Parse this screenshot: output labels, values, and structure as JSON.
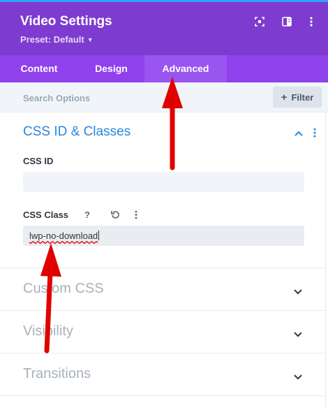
{
  "header": {
    "title": "Video Settings",
    "preset_label": "Preset: Default",
    "icons": [
      "focus-icon",
      "split-view-icon",
      "more-vertical-icon"
    ]
  },
  "tabs": [
    {
      "label": "Content",
      "active": false
    },
    {
      "label": "Design",
      "active": false
    },
    {
      "label": "Advanced",
      "active": true
    }
  ],
  "search": {
    "placeholder": "Search Options",
    "value": "",
    "filter_label": "Filter"
  },
  "sections": {
    "css": {
      "title": "CSS ID & Classes",
      "expanded": true,
      "css_id": {
        "label": "CSS ID",
        "value": ""
      },
      "css_class": {
        "label": "CSS Class",
        "value": "lwp-no-download"
      }
    },
    "collapsed": [
      {
        "title": "Custom CSS"
      },
      {
        "title": "Visibility"
      },
      {
        "title": "Transitions"
      }
    ]
  },
  "colors": {
    "header_bg": "#7e3bd0",
    "tabs_bg": "#8f42ec",
    "active_tab_bg": "#9a54f0",
    "accent_blue": "#2b87da",
    "annotation_red": "#e10000"
  }
}
